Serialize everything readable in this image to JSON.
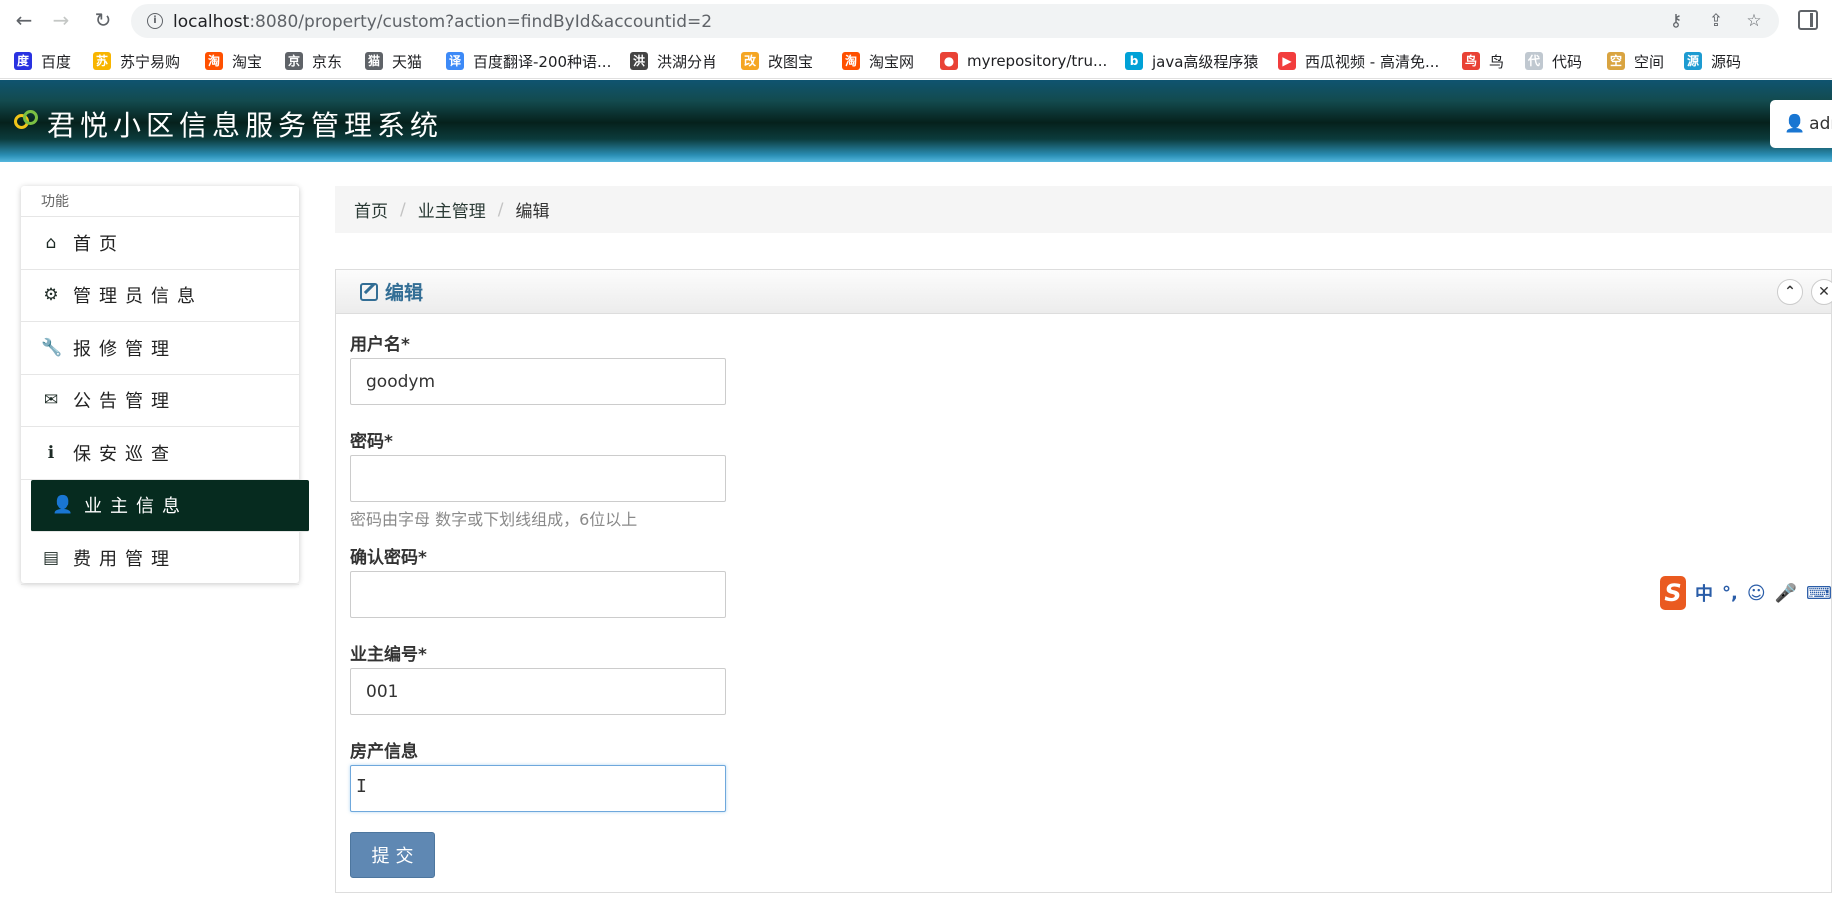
{
  "browser": {
    "back_icon": "←",
    "forward_icon": "→",
    "reload_icon": "↻",
    "url_host": "localhost",
    "url_rest": ":8080/property/custom?action=findById&accountid=2",
    "key_icon": "⚷",
    "share_icon": "⇪",
    "star_icon": "☆"
  },
  "bookmarks": [
    {
      "label": "百度",
      "icon": "度",
      "color": "#2932e1"
    },
    {
      "label": "苏宁易购",
      "icon": "苏",
      "color": "#f8b500"
    },
    {
      "label": "淘宝",
      "icon": "淘",
      "color": "#ff5000"
    },
    {
      "label": "京东",
      "icon": "京",
      "color": "#5f6368"
    },
    {
      "label": "天猫",
      "icon": "猫",
      "color": "#5f6368"
    },
    {
      "label": "百度翻译-200种语...",
      "icon": "译",
      "color": "#3d8af7"
    },
    {
      "label": "洪湖分肖",
      "icon": "洪",
      "color": "#444444"
    },
    {
      "label": "改图宝",
      "icon": "改",
      "color": "#f5a623"
    },
    {
      "label": "淘宝网",
      "icon": "淘",
      "color": "#ff5000"
    },
    {
      "label": "myrepository/tru...",
      "icon": "●",
      "color": "#e94235"
    },
    {
      "label": "java高级程序猿",
      "icon": "b",
      "color": "#00a1d6"
    },
    {
      "label": "西瓜视频 - 高清免...",
      "icon": "▶",
      "color": "#f23d3d"
    },
    {
      "label": "鸟",
      "icon": "鸟",
      "color": "#e94235"
    },
    {
      "label": "代码",
      "icon": "代",
      "color": "#c0c8d0"
    },
    {
      "label": "空间",
      "icon": "空",
      "color": "#d9a441"
    },
    {
      "label": "源码",
      "icon": "源",
      "color": "#1d9bd1"
    }
  ],
  "header": {
    "title": "君悦小区信息服务管理系统",
    "user_label": "adm",
    "user_icon": "👤"
  },
  "sidebar": {
    "header": "功能",
    "items": [
      {
        "label": "首页",
        "icon": "⌂",
        "active": false
      },
      {
        "label": "管理员信息",
        "icon": "⚙",
        "active": false
      },
      {
        "label": "报修管理",
        "icon": "🔧",
        "active": false
      },
      {
        "label": "公告管理",
        "icon": "✉",
        "active": false
      },
      {
        "label": "保安巡查",
        "icon": "ℹ",
        "active": false
      },
      {
        "label": "业主信息",
        "icon": "👤",
        "active": true
      },
      {
        "label": "费用管理",
        "icon": "▤",
        "active": false
      }
    ]
  },
  "breadcrumb": {
    "items": [
      "首页",
      "业主管理",
      "编辑"
    ],
    "separator": "/"
  },
  "panel": {
    "title": "编辑",
    "collapse_icon": "⌃",
    "close_icon": "✕"
  },
  "form": {
    "username_label": "用户名*",
    "username_value": "goodym",
    "password_label": "密码*",
    "password_value": "",
    "password_help": "密码由字母 数字或下划线组成，6位以上",
    "confirm_label": "确认密码*",
    "confirm_value": "",
    "owner_no_label": "业主编号*",
    "owner_no_value": "001",
    "property_label": "房产信息",
    "property_value": "",
    "submit_label": "提交"
  },
  "ime": {
    "logo": "S",
    "mode": "中",
    "punct": "°,",
    "emoji": "☺",
    "mic": "🎤",
    "keyboard": "⌨"
  }
}
